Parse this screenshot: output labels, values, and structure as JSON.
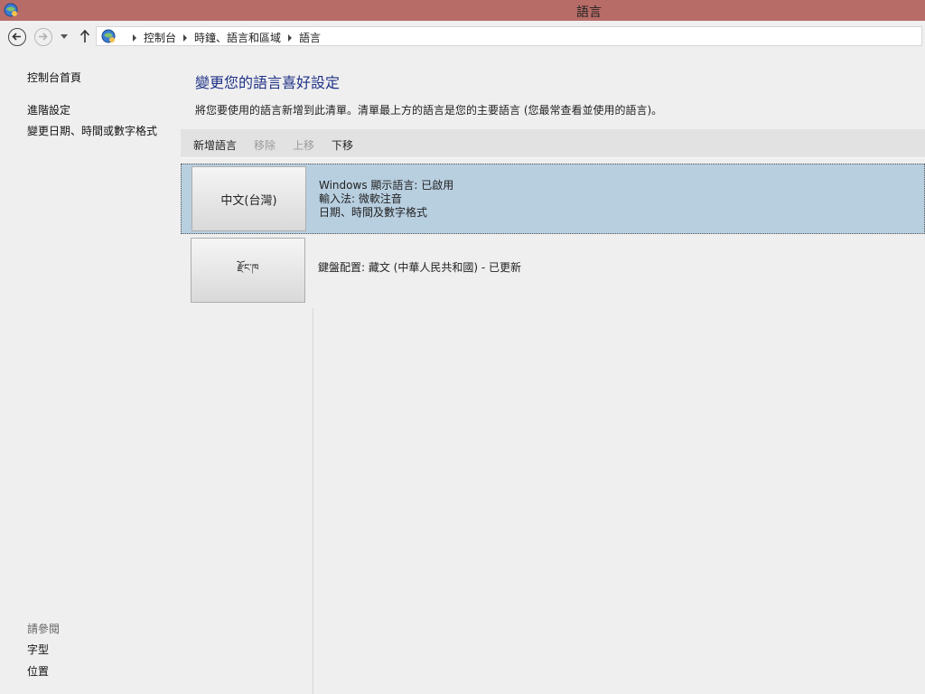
{
  "window": {
    "title": "語言"
  },
  "nav": {
    "breadcrumbs": [
      "控制台",
      "時鐘、語言和區域",
      "語言"
    ]
  },
  "sidebar": {
    "home": "控制台首頁",
    "links": [
      "進階設定",
      "變更日期、時間或數字格式"
    ],
    "see_also_label": "請參閱",
    "see_also": [
      "字型",
      "位置"
    ]
  },
  "main": {
    "heading": "變更您的語言喜好設定",
    "description": "將您要使用的語言新增到此清單。清單最上方的語言是您的主要語言 (您最常查看並使用的語言)。",
    "toolbar": {
      "add": "新增語言",
      "remove": "移除",
      "move_up": "上移",
      "move_down": "下移"
    },
    "languages": [
      {
        "name": "中文(台灣)",
        "details": [
          "Windows 顯示語言: 已啟用",
          "輸入法: 微軟注音",
          "日期、時間及數字格式"
        ]
      },
      {
        "name": "རྫོང་ཁ",
        "details": [
          "鍵盤配置: 藏文 (中華人民共和國) - 已更新"
        ]
      }
    ]
  }
}
